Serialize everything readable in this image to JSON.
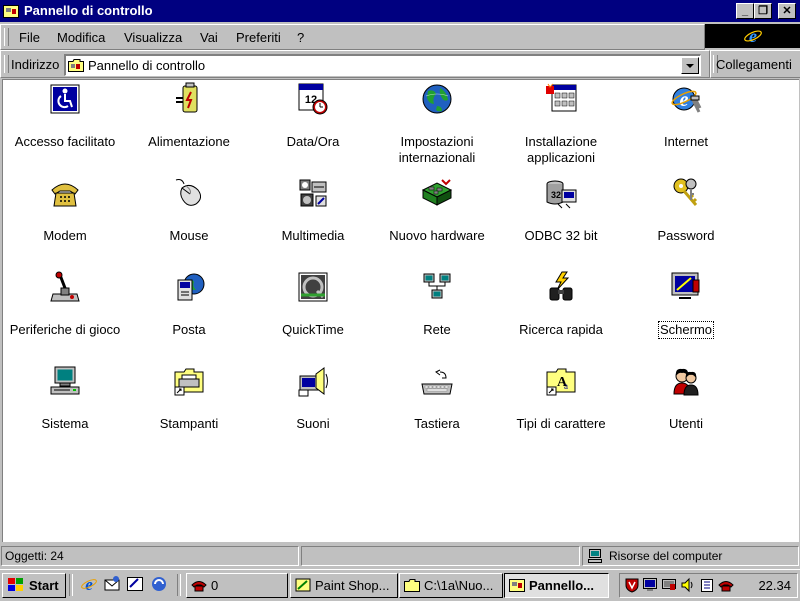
{
  "window": {
    "title": "Pannello di controllo"
  },
  "menu": [
    "File",
    "Modifica",
    "Visualizza",
    "Vai",
    "Preferiti",
    "?"
  ],
  "address": {
    "label": "Indirizzo",
    "value": "Pannello di controllo",
    "links_label": "Collegamenti"
  },
  "icons": [
    {
      "label": "Accesso facilitato",
      "icon": "accessibility-icon"
    },
    {
      "label": "Alimentazione",
      "icon": "power-icon"
    },
    {
      "label": "Data/Ora",
      "icon": "calendar-clock-icon"
    },
    {
      "label": "Impostazioni internazionali",
      "icon": "globe-icon"
    },
    {
      "label": "Installazione applicazioni",
      "icon": "install-icon"
    },
    {
      "label": "Internet",
      "icon": "internet-icon"
    },
    {
      "label": "Modem",
      "icon": "phone-icon"
    },
    {
      "label": "Mouse",
      "icon": "mouse-icon"
    },
    {
      "label": "Multimedia",
      "icon": "multimedia-icon"
    },
    {
      "label": "Nuovo hardware",
      "icon": "hardware-icon"
    },
    {
      "label": "ODBC 32 bit",
      "icon": "odbc-icon"
    },
    {
      "label": "Password",
      "icon": "keys-icon"
    },
    {
      "label": "Periferiche di gioco",
      "icon": "joystick-icon"
    },
    {
      "label": "Posta",
      "icon": "mail-icon"
    },
    {
      "label": "QuickTime",
      "icon": "quicktime-icon"
    },
    {
      "label": "Rete",
      "icon": "network-icon"
    },
    {
      "label": "Ricerca rapida",
      "icon": "binoculars-icon"
    },
    {
      "label": "Schermo",
      "icon": "display-icon"
    },
    {
      "label": "Sistema",
      "icon": "computer-icon"
    },
    {
      "label": "Stampanti",
      "icon": "printer-folder-icon"
    },
    {
      "label": "Suoni",
      "icon": "speaker-icon"
    },
    {
      "label": "Tastiera",
      "icon": "keyboard-icon"
    },
    {
      "label": "Tipi di carattere",
      "icon": "fonts-folder-icon"
    },
    {
      "label": "Utenti",
      "icon": "users-icon"
    }
  ],
  "status": {
    "objects": "Oggetti: 24",
    "location": "Risorse del computer"
  },
  "taskbar": {
    "start_label": "Start",
    "phone_count": "0",
    "buttons": [
      "Paint Shop...",
      "C:\\1a\\Nuo...",
      "Pannello..."
    ],
    "clock": "22.34"
  },
  "colors": {
    "titlebar": "#000080",
    "face": "#c0c0c0",
    "content_bg": "#ffffff"
  }
}
